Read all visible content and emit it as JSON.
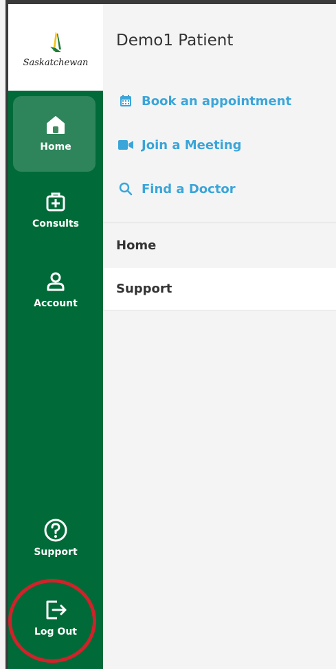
{
  "logo": {
    "text": "Saskatchewan",
    "icon": "wheat-sheaf-logo"
  },
  "sidebar": {
    "items": [
      {
        "label": "Home",
        "icon": "home-icon",
        "active": true
      },
      {
        "label": "Consults",
        "icon": "medical-kit-icon",
        "active": false
      },
      {
        "label": "Account",
        "icon": "user-icon",
        "active": false
      },
      {
        "label": "Support",
        "icon": "help-circle-icon",
        "active": false
      },
      {
        "label": "Log Out",
        "icon": "logout-icon",
        "active": false
      }
    ]
  },
  "header": {
    "patient_name": "Demo1 Patient"
  },
  "quick_links": [
    {
      "label": "Book an appointment",
      "icon": "calendar-icon"
    },
    {
      "label": "Join a Meeting",
      "icon": "video-icon"
    },
    {
      "label": "Find a Doctor",
      "icon": "search-icon"
    }
  ],
  "menu": [
    {
      "label": "Home"
    },
    {
      "label": "Support"
    }
  ],
  "colors": {
    "sidebar": "#006b38",
    "link": "#3aa5d9",
    "highlight_ring": "#d0222a"
  }
}
